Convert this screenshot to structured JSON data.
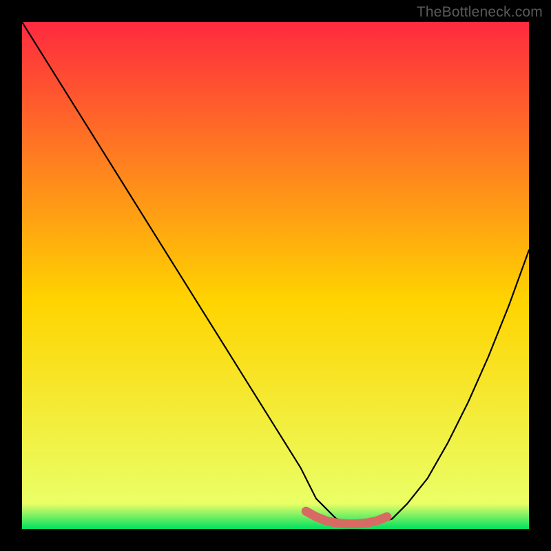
{
  "watermark": "TheBottleneck.com",
  "chart_data": {
    "type": "line",
    "title": "",
    "xlabel": "",
    "ylabel": "",
    "xlim": [
      0,
      100
    ],
    "ylim": [
      0,
      100
    ],
    "background_gradient": {
      "top": "#ff2a3f",
      "mid": "#ffd400",
      "bottom": "#00e060"
    },
    "series": [
      {
        "name": "bottleneck-curve",
        "color": "#000000",
        "x": [
          0,
          5,
          10,
          15,
          20,
          25,
          30,
          35,
          40,
          45,
          50,
          55,
          58,
          62,
          66,
          70,
          73,
          76,
          80,
          84,
          88,
          92,
          96,
          100
        ],
        "values": [
          100,
          92,
          84,
          76,
          68,
          60,
          52,
          44,
          36,
          28,
          20,
          12,
          6,
          2,
          1,
          1,
          2,
          5,
          10,
          17,
          25,
          34,
          44,
          55
        ]
      },
      {
        "name": "optimal-zone-marker",
        "color": "#d86a64",
        "x": [
          56,
          58,
          60,
          62,
          64,
          66,
          68,
          70,
          72
        ],
        "values": [
          3.5,
          2.4,
          1.6,
          1.2,
          1.0,
          1.0,
          1.2,
          1.6,
          2.4
        ]
      }
    ]
  }
}
